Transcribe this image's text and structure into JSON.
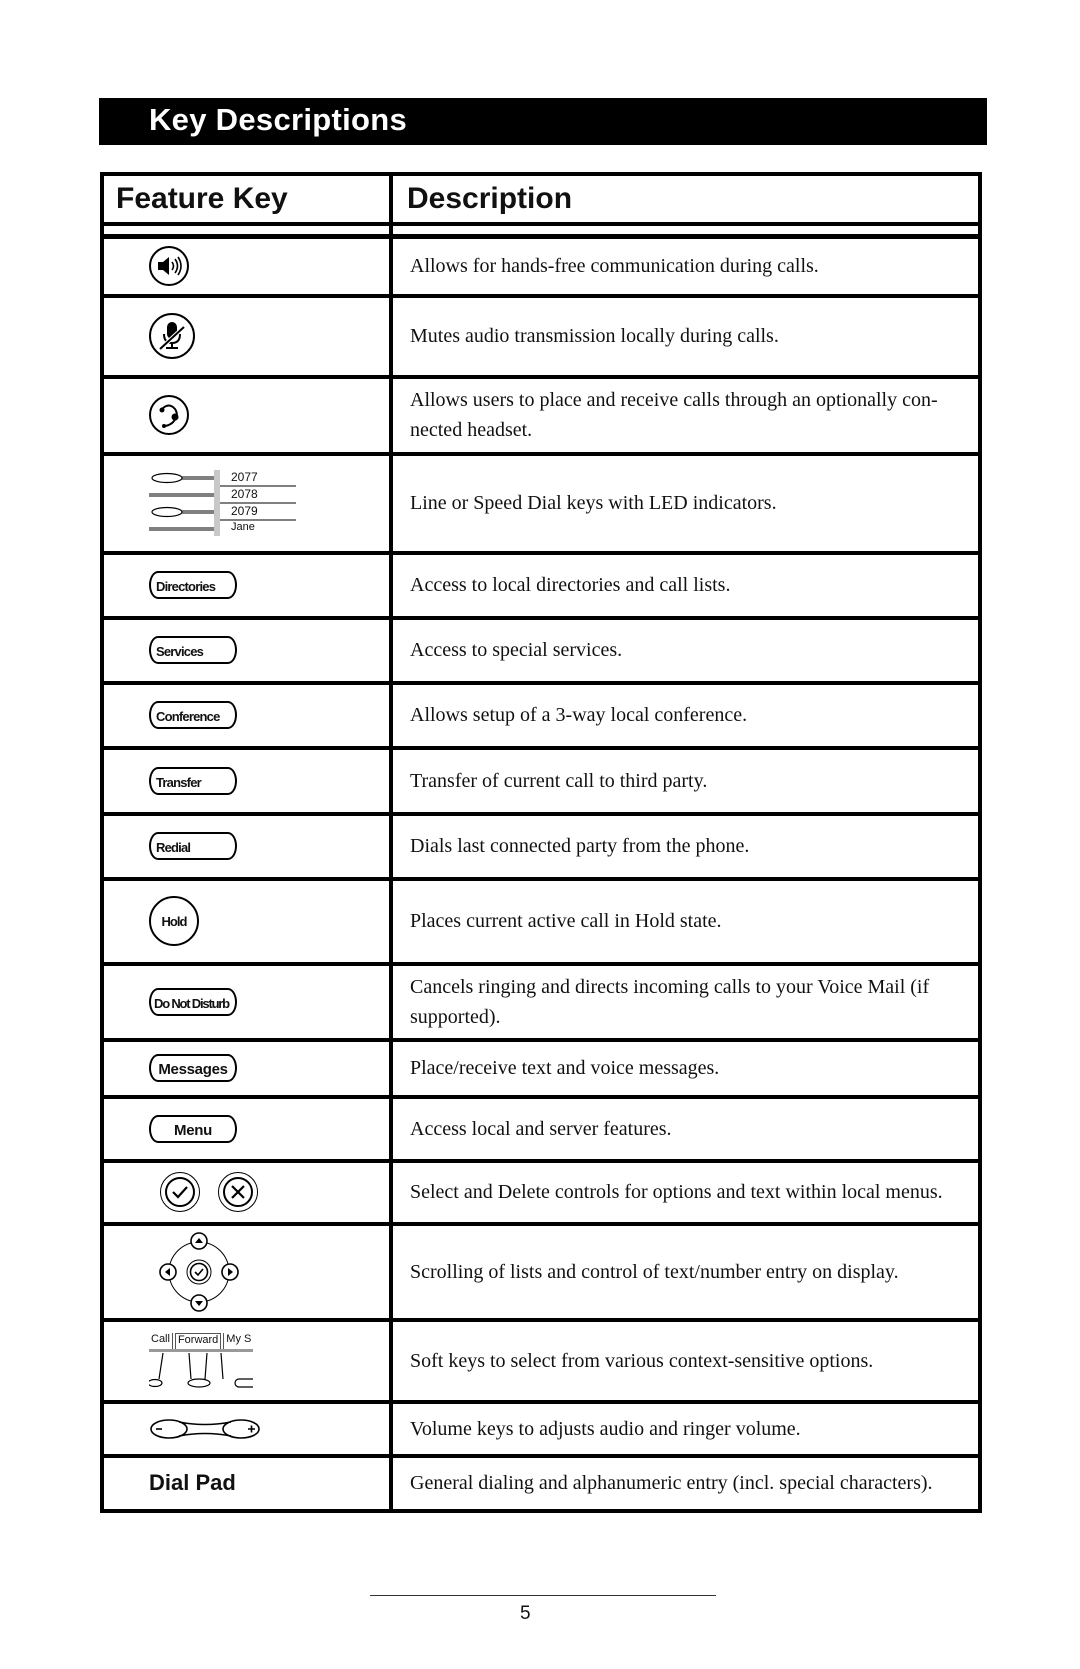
{
  "title": "Key Descriptions",
  "table": {
    "headers": {
      "feature_key": "Feature Key",
      "description": "Description"
    },
    "rows": [
      {
        "key_icon": "speakerphone-icon",
        "description": "Allows for hands-free communication during calls."
      },
      {
        "key_icon": "mute-microphone-icon",
        "description": "Mutes audio transmission locally during calls."
      },
      {
        "key_icon": "headset-icon",
        "description": "Allows users to place and receive calls through an optionally con-nected headset."
      },
      {
        "key_icon": "line-keys-icon",
        "line_labels": [
          "2077",
          "2078",
          "2079",
          "Jane"
        ],
        "description": "Line or Speed Dial keys with LED indicators."
      },
      {
        "key_label": "Directories",
        "description": "Access to local directories and call lists."
      },
      {
        "key_label": "Services",
        "description": "Access to special services."
      },
      {
        "key_label": "Conference",
        "description": "Allows setup of a 3-way local conference."
      },
      {
        "key_label": "Transfer",
        "description": "Transfer of current call to third party."
      },
      {
        "key_label": "Redial",
        "description": "Dials last connected party from the phone."
      },
      {
        "key_label": "Hold",
        "description": "Places current active call in Hold state."
      },
      {
        "key_label": "Do Not Disturb",
        "description": "Cancels ringing and directs incoming calls to your Voice Mail (if supported)."
      },
      {
        "key_label": "Messages",
        "description": "Place/receive text and voice messages."
      },
      {
        "key_label": "Menu",
        "description": "Access local and server features."
      },
      {
        "key_icon": "select-delete-icons",
        "description": "Select and Delete controls for options and text within local menus."
      },
      {
        "key_icon": "navigation-pad-icon",
        "description": "Scrolling of lists and control of text/number entry on display."
      },
      {
        "key_icon": "soft-keys-icon",
        "soft_key_labels": [
          "Call",
          "Forward",
          "My S"
        ],
        "description": "Soft keys to select from various context-sensitive options."
      },
      {
        "key_icon": "volume-keys-icon",
        "description": "Volume keys to adjusts audio and ringer volume."
      },
      {
        "key_label": "Dial Pad",
        "description": "General dialing and alphanumeric entry (incl. special characters)."
      }
    ]
  },
  "page_number": "5"
}
